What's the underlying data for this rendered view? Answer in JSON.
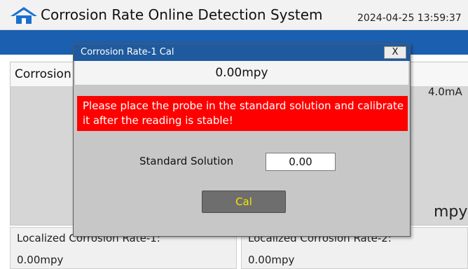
{
  "header": {
    "title": "Corrosion Rate Online Detection System",
    "datetime": "2024-04-25 13:59:37",
    "home_icon": "home-icon"
  },
  "main": {
    "title": "Corrosion Rate-1",
    "current_reading": "4.0mA",
    "unit": "mpy"
  },
  "cards": [
    {
      "label": "Localized Corrosion Rate-1:",
      "value": "0.00mpy"
    },
    {
      "label": "Localized Corrosion Rate-2:",
      "value": "0.00mpy"
    }
  ],
  "dialog": {
    "title": "Corrosion Rate-1 Cal",
    "close_label": "X",
    "reading": "0.00mpy",
    "warning": "Please place the probe in the standard solution and calibrate it after the reading is stable!",
    "standard_solution_label": "Standard Solution",
    "standard_solution_value": "0.00",
    "cal_button_label": "Cal"
  },
  "colors": {
    "header_bar": "#1b5fb0",
    "dialog_titlebar": "#1f5a9f",
    "warning_bg": "#ff0000",
    "cal_text": "#f2e600"
  }
}
